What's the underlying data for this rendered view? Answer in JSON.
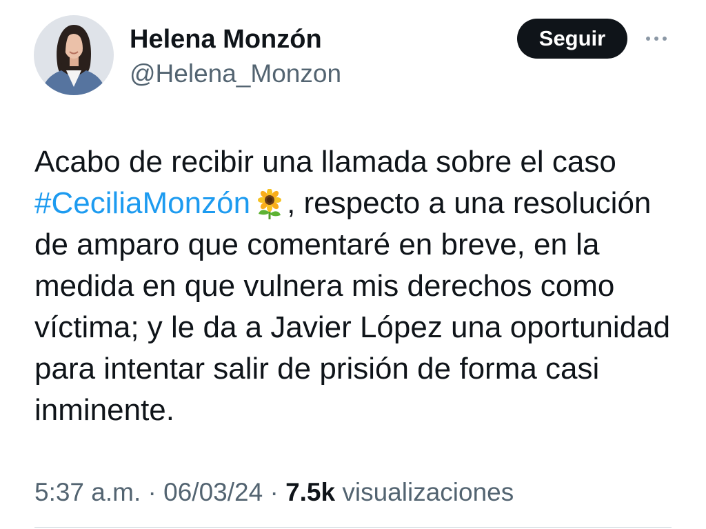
{
  "author": {
    "name": "Helena Monzón",
    "handle": "@Helena_Monzon"
  },
  "actions": {
    "follow_label": "Seguir"
  },
  "icons": {
    "more": "more-horizontal-icon",
    "emoji": "sunflower-icon",
    "avatar": "profile-photo"
  },
  "tweet": {
    "lines": [
      {
        "text": "Acabo de recibir una llamada sobre el caso"
      },
      {
        "hashtag": "#CeciliaMonzón",
        "text": ", respecto a una resolución"
      },
      {
        "text": "de amparo que comentaré en breve, en la"
      },
      {
        "text": "medida en que vulnera mis derechos como"
      },
      {
        "text": "víctima; y le da a Javier López una oportunidad"
      },
      {
        "text": "para intentar salir de prisión de forma casi"
      },
      {
        "text": "inminente."
      }
    ]
  },
  "meta": {
    "time": "5:37 a.m.",
    "separator": "·",
    "date": "06/03/24",
    "views_count": "7.5k",
    "views_label": "visualizaciones"
  },
  "colors": {
    "text": "#0f1419",
    "secondary_text": "#536471",
    "link": "#1d9bf0",
    "button_background": "#0f1419",
    "button_text": "#ffffff",
    "divider": "#cfd9de",
    "background": "#ffffff"
  }
}
